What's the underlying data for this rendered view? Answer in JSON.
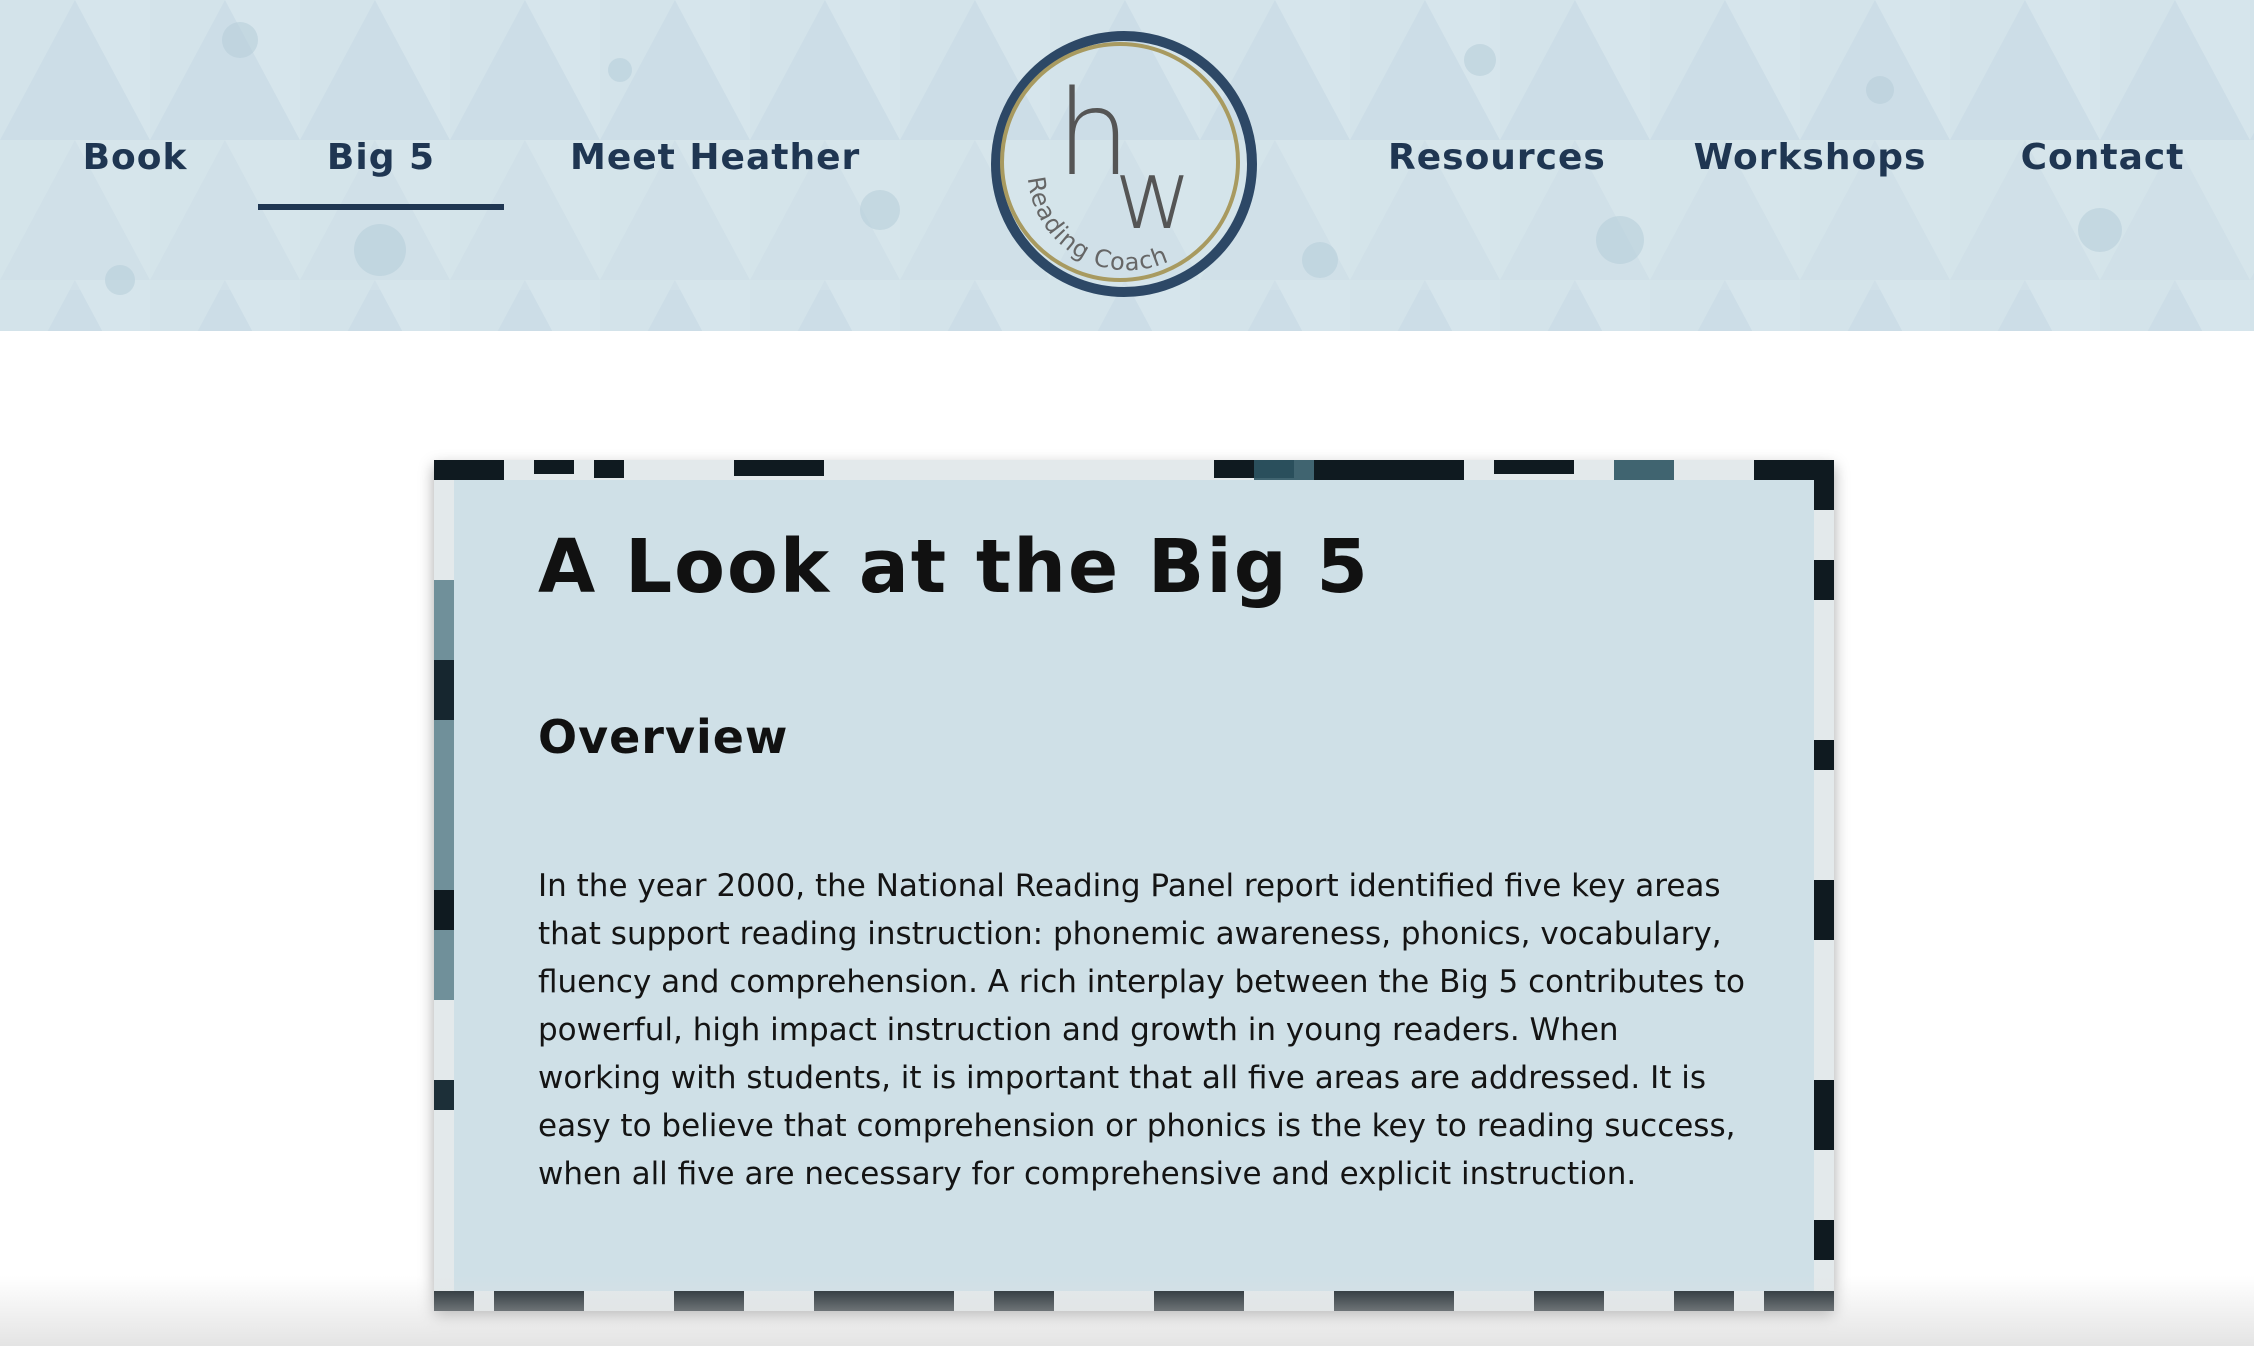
{
  "nav": {
    "left": [
      {
        "label": "Book",
        "active": false
      },
      {
        "label": "Big 5",
        "active": true
      },
      {
        "label": "Meet Heather",
        "active": false
      }
    ],
    "right": [
      {
        "label": "Resources",
        "active": false
      },
      {
        "label": "Workshops",
        "active": false
      },
      {
        "label": "Contact",
        "active": false
      }
    ]
  },
  "logo": {
    "initial_h": "h",
    "initial_w": "w",
    "tagline": "Reading Coach"
  },
  "content": {
    "title": "A Look at the Big 5",
    "heading": "Overview",
    "paragraph_lines": [
      "In the year 2000, the National Reading Panel report identified five key areas",
      "that support reading instruction: phonemic awareness, phonics, vocabulary,",
      "fluency and comprehension. A rich interplay between the Big 5 contributes to",
      "powerful, high impact instruction and growth in young readers. When",
      "working with students, it is important that all five areas are addressed. It is",
      "easy to believe that comprehension or phonics is the key to reading success,",
      "when all five are necessary for comprehensive and explicit instruction."
    ]
  },
  "colors": {
    "nav_text": "#1f3652",
    "header_bg": "#d2e2ea",
    "panel_bg": "#cfe0e7",
    "logo_ring_outer": "#2d4866",
    "logo_ring_inner": "#a89a60"
  }
}
